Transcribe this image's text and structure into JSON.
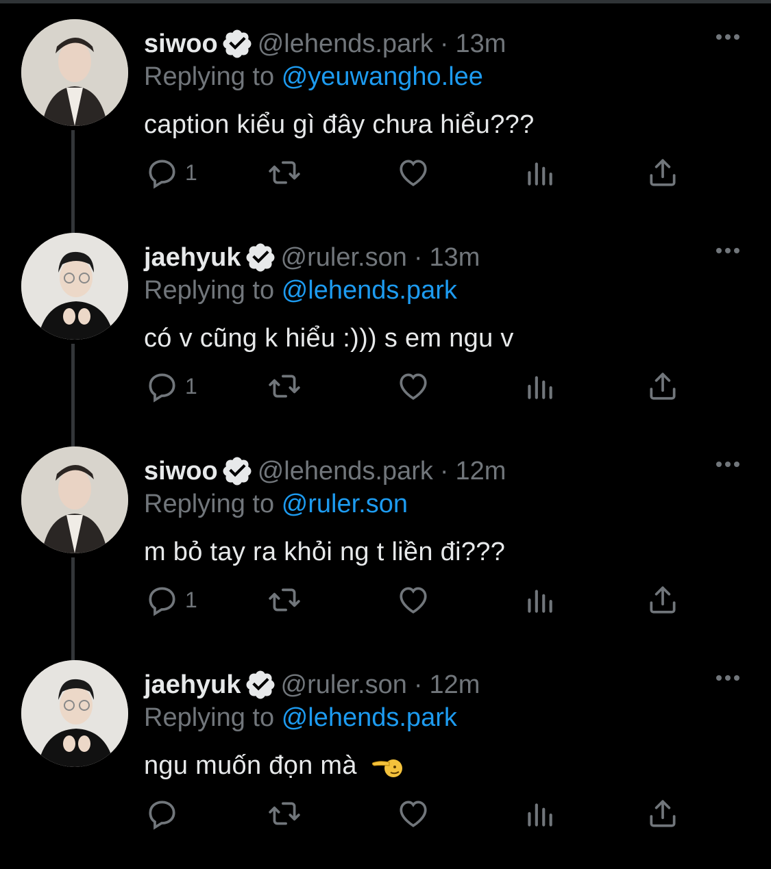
{
  "colors": {
    "background": "#000000",
    "primary_text": "#e7e9ea",
    "secondary_text": "#71767b",
    "link": "#1d9bf0",
    "verified": "#e7e9ea",
    "thread_line": "#333639"
  },
  "replying_prefix": "Replying to",
  "tweets": [
    {
      "name": "siwoo",
      "handle": "@lehends.park",
      "time": "13m",
      "replying_to": "@yeuwangho.lee",
      "text": "caption kiểu gì đây chưa hiểu???",
      "reply_count": "1",
      "verified": true,
      "avatar": "siwoo-avatar"
    },
    {
      "name": "jaehyuk",
      "handle": "@ruler.son",
      "time": "13m",
      "replying_to": "@lehends.park",
      "text": "có v cũng k hiểu :))) s em ngu v",
      "reply_count": "1",
      "verified": true,
      "avatar": "jaehyuk-avatar"
    },
    {
      "name": "siwoo",
      "handle": "@lehends.park",
      "time": "12m",
      "replying_to": "@ruler.son",
      "text": "m bỏ tay ra khỏi ng t liền đi???",
      "reply_count": "1",
      "verified": true,
      "avatar": "siwoo-avatar"
    },
    {
      "name": "jaehyuk",
      "handle": "@ruler.son",
      "time": "12m",
      "replying_to": "@lehends.park",
      "text": "ngu muốn đọn mà",
      "reply_count": "",
      "verified": true,
      "avatar": "jaehyuk-avatar",
      "emoji": "pointing-left-emoji"
    }
  ],
  "action_icons": [
    "reply-icon",
    "retweet-icon",
    "like-icon",
    "views-icon",
    "share-icon"
  ],
  "more_icon": "more-options-icon"
}
